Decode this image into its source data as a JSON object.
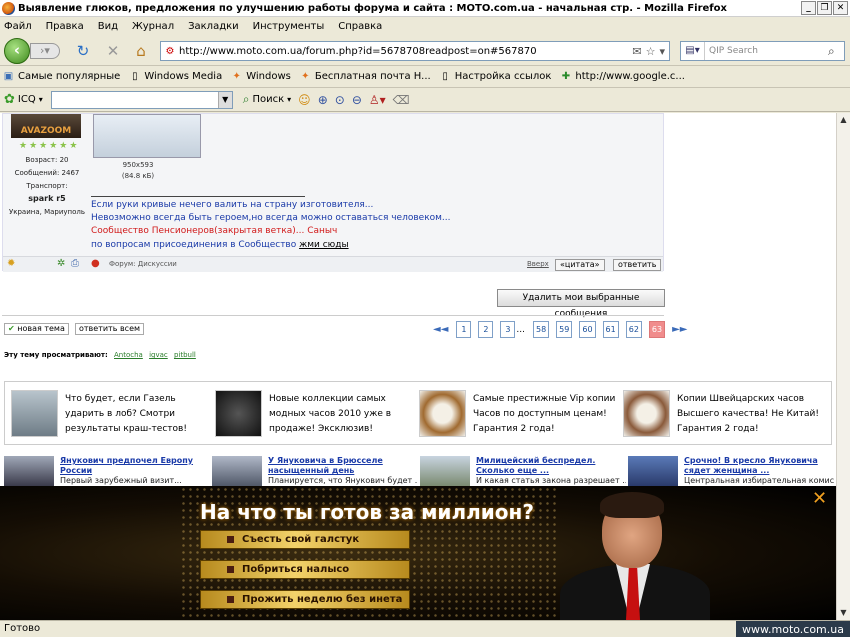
{
  "window": {
    "title": "Выявление глюков, предложения по улучшению работы форума и сайта : MOTO.com.ua - начальная стр. - Mozilla Firefox",
    "min": "_",
    "max": "❐",
    "close": "✕"
  },
  "menu": [
    "Файл",
    "Правка",
    "Вид",
    "Журнал",
    "Закладки",
    "Инструменты",
    "Справка"
  ],
  "nav": {
    "url": "http://www.moto.com.ua/forum.php?id=5678708readpost=on#567870",
    "search_placeholder": "QIP Search"
  },
  "bookmarks": [
    "Самые популярные",
    "Windows Media",
    "Windows",
    "Бесплатная почта H...",
    "Настройка ссылок",
    "http://www.google.c..."
  ],
  "toolbar2": {
    "icq": "ICQ",
    "find": "Поиск"
  },
  "post": {
    "avatar_text": "AVAZOOM",
    "user_age": "Возраст: 20",
    "user_msgs": "Сообщений: 2467",
    "user_transport_label": "Транспорт:",
    "user_transport": "spark r5",
    "user_location": "Украина, Мариуполь",
    "thumb_size": "950x593",
    "thumb_kb": "(84.8 кБ)",
    "sig1": "Если руки кривые нечего валить на страну изготовителя...",
    "sig2": "Невозможно всегда быть героем,но всегда можно оставаться человеком...",
    "sig3": "Сообщество Пенсионеров(закрытая ветка)... Саныч",
    "sig4_prefix": "по вопросам присоединения в Сообщество ",
    "sig4_link": "жми сюды",
    "footer_label": "Форум: Дискуссии",
    "up": "Вверх",
    "quote": "«цитата»",
    "reply": "ответить"
  },
  "delete_selected": "Удалить мои выбранные сообщения",
  "new_topic": "новая тема",
  "reply_all": "ответить всем",
  "pager": {
    "pages": [
      "1",
      "2",
      "3",
      "58",
      "59",
      "60",
      "61",
      "62",
      "63"
    ],
    "dots": "...",
    "active": "63"
  },
  "viewed": {
    "label": "Эту тему просматривают:",
    "users": [
      "Antocha",
      "igvac",
      "pitbull"
    ]
  },
  "ads": [
    {
      "text": "Что будет, если Газель ударить в лоб? Смотри результаты краш-тестов!"
    },
    {
      "text": "Новые коллекции самых модных часов 2010 уже в продаже! Эксклюзив!"
    },
    {
      "text": "Самые престижные Vip копии Часов по доступным ценам! Гарантия 2 года!"
    },
    {
      "text": "Копии Швейцарских часов Высшего качества! Не Китай! Гарантия 2 года!"
    }
  ],
  "news": [
    {
      "title": "Янукович предпочел Европу России",
      "desc": "Первый зарубежный визит..."
    },
    {
      "title": "У Януковича в Брюсселе насыщенный день",
      "desc": "Планируется, что Янукович будет ..."
    },
    {
      "title": "Милицейский беспредел. Сколько еще ...",
      "desc": "И какая статья закона разрешает ..."
    },
    {
      "title": "Срочно! В кресло Януковича сядет женщина ...",
      "desc": "Центральная избирательная комиссия"
    }
  ],
  "banner": {
    "headline": "На что ты готов за миллион?",
    "options": [
      "Съесть свой галстук",
      "Побриться налысо",
      "Прожить неделю без инета"
    ],
    "close": "✕"
  },
  "status": {
    "text": "Готово",
    "watermark": "www.moto.com.ua"
  },
  "colors": {
    "link": "#1a3aa8",
    "red_sig": "#d11a1a",
    "active_page": "#f08c8c"
  }
}
